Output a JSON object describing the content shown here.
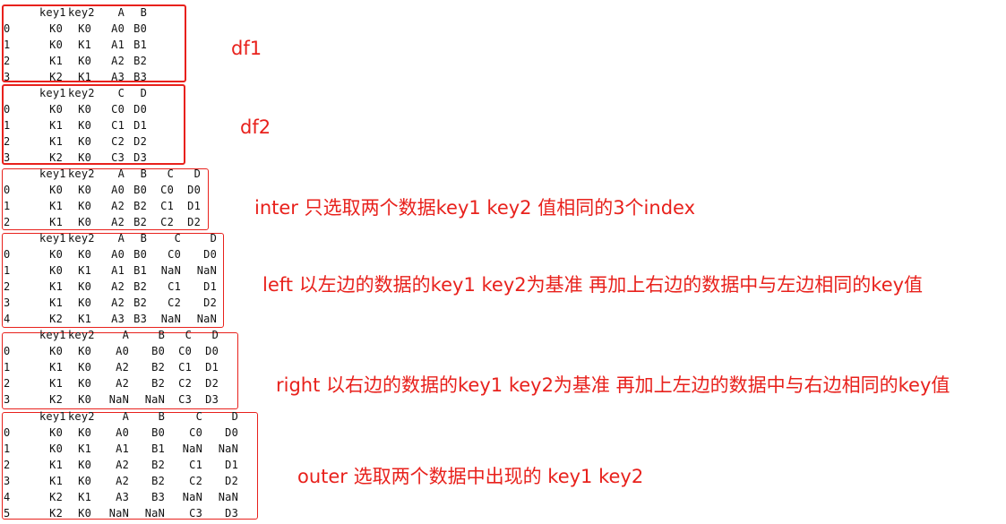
{
  "labels": {
    "df1": "df1",
    "df2": "df2",
    "inner": "inter 只选取两个数据key1 key2 值相同的3个index",
    "left": "left 以左边的数据的key1 key2为基准 再加上右边的数据中与左边相同的key值",
    "right": "right 以右边的数据的key1 key2为基准 再加上左边的数据中与右边相同的key值",
    "outer": "outer 选取两个数据中出现的 key1 key2"
  },
  "tables": {
    "df1": {
      "columns": [
        "key1",
        "key2",
        "A",
        "B"
      ],
      "index": [
        "0",
        "1",
        "2",
        "3"
      ],
      "rows": [
        [
          "K0",
          "K0",
          "A0",
          "B0"
        ],
        [
          "K0",
          "K1",
          "A1",
          "B1"
        ],
        [
          "K1",
          "K0",
          "A2",
          "B2"
        ],
        [
          "K2",
          "K1",
          "A3",
          "B3"
        ]
      ]
    },
    "df2": {
      "columns": [
        "key1",
        "key2",
        "C",
        "D"
      ],
      "index": [
        "0",
        "1",
        "2",
        "3"
      ],
      "rows": [
        [
          "K0",
          "K0",
          "C0",
          "D0"
        ],
        [
          "K1",
          "K0",
          "C1",
          "D1"
        ],
        [
          "K1",
          "K0",
          "C2",
          "D2"
        ],
        [
          "K2",
          "K0",
          "C3",
          "D3"
        ]
      ]
    },
    "inner": {
      "columns": [
        "key1",
        "key2",
        "A",
        "B",
        "C",
        "D"
      ],
      "index": [
        "0",
        "1",
        "2"
      ],
      "rows": [
        [
          "K0",
          "K0",
          "A0",
          "B0",
          "C0",
          "D0"
        ],
        [
          "K1",
          "K0",
          "A2",
          "B2",
          "C1",
          "D1"
        ],
        [
          "K1",
          "K0",
          "A2",
          "B2",
          "C2",
          "D2"
        ]
      ]
    },
    "left": {
      "columns": [
        "key1",
        "key2",
        "A",
        "B",
        "C",
        "D"
      ],
      "index": [
        "0",
        "1",
        "2",
        "3",
        "4"
      ],
      "rows": [
        [
          "K0",
          "K0",
          "A0",
          "B0",
          "C0",
          "D0"
        ],
        [
          "K0",
          "K1",
          "A1",
          "B1",
          "NaN",
          "NaN"
        ],
        [
          "K1",
          "K0",
          "A2",
          "B2",
          "C1",
          "D1"
        ],
        [
          "K1",
          "K0",
          "A2",
          "B2",
          "C2",
          "D2"
        ],
        [
          "K2",
          "K1",
          "A3",
          "B3",
          "NaN",
          "NaN"
        ]
      ]
    },
    "right": {
      "columns": [
        "key1",
        "key2",
        "A",
        "B",
        "C",
        "D"
      ],
      "index": [
        "0",
        "1",
        "2",
        "3"
      ],
      "rows": [
        [
          "K0",
          "K0",
          "A0",
          "B0",
          "C0",
          "D0"
        ],
        [
          "K1",
          "K0",
          "A2",
          "B2",
          "C1",
          "D1"
        ],
        [
          "K1",
          "K0",
          "A2",
          "B2",
          "C2",
          "D2"
        ],
        [
          "K2",
          "K0",
          "NaN",
          "NaN",
          "C3",
          "D3"
        ]
      ]
    },
    "outer": {
      "columns": [
        "key1",
        "key2",
        "A",
        "B",
        "C",
        "D"
      ],
      "index": [
        "0",
        "1",
        "2",
        "3",
        "4",
        "5"
      ],
      "rows": [
        [
          "K0",
          "K0",
          "A0",
          "B0",
          "C0",
          "D0"
        ],
        [
          "K0",
          "K1",
          "A1",
          "B1",
          "NaN",
          "NaN"
        ],
        [
          "K1",
          "K0",
          "A2",
          "B2",
          "C1",
          "D1"
        ],
        [
          "K1",
          "K0",
          "A2",
          "B2",
          "C2",
          "D2"
        ],
        [
          "K2",
          "K1",
          "A3",
          "B3",
          "NaN",
          "NaN"
        ],
        [
          "K2",
          "K0",
          "NaN",
          "NaN",
          "C3",
          "D3"
        ]
      ]
    }
  }
}
